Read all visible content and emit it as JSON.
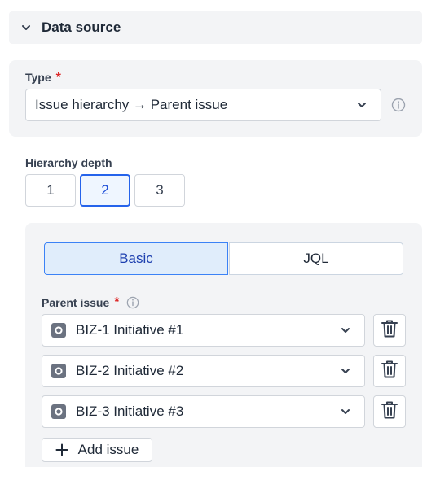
{
  "section": {
    "title": "Data source",
    "icon": "chevron-down-icon"
  },
  "type_field": {
    "label": "Type",
    "required_mark": "*",
    "value": "Issue hierarchy → Parent issue",
    "icon": "info-icon"
  },
  "hierarchy_depth": {
    "label": "Hierarchy depth",
    "options": [
      "1",
      "2",
      "3"
    ],
    "selected": "2"
  },
  "mode_tabs": {
    "tabs": [
      "Basic",
      "JQL"
    ],
    "selected": "Basic"
  },
  "parent_issue": {
    "label": "Parent issue",
    "required_mark": "*",
    "items": [
      {
        "value": "BIZ-1 Initiative #1"
      },
      {
        "value": "BIZ-2 Initiative #2"
      },
      {
        "value": "BIZ-3 Initiative #3"
      }
    ],
    "add_label": "Add issue"
  },
  "colors": {
    "accent": "#2563eb",
    "required": "#dc2626",
    "panel_bg": "#f3f4f6",
    "selected_bg": "#e0edfb"
  }
}
